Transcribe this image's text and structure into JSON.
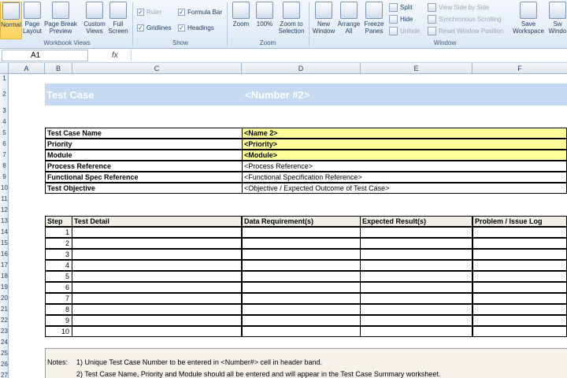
{
  "ribbon": {
    "workbook_views": {
      "buttons": [
        "Normal",
        "Page Layout",
        "Page Break Preview",
        "Custom Views",
        "Full Screen"
      ],
      "label": "Workbook Views"
    },
    "show": {
      "items": [
        {
          "label": "Ruler",
          "checked": true,
          "disabled": true
        },
        {
          "label": "Formula Bar",
          "checked": true,
          "disabled": false
        },
        {
          "label": "Gridlines",
          "checked": true,
          "disabled": false
        },
        {
          "label": "Headings",
          "checked": true,
          "disabled": false
        }
      ],
      "label": "Show"
    },
    "zoom": {
      "buttons": [
        "Zoom",
        "100%",
        "Zoom to Selection"
      ],
      "label": "Zoom"
    },
    "window": {
      "buttons": [
        "New Window",
        "Arrange All",
        "Freeze Panes"
      ],
      "small": [
        {
          "label": "Split",
          "disabled": false
        },
        {
          "label": "Hide",
          "disabled": false
        },
        {
          "label": "Unhide",
          "disabled": true
        },
        {
          "label": "View Side by Side",
          "disabled": true
        },
        {
          "label": "Synchronous Scrolling",
          "disabled": true
        },
        {
          "label": "Reset Window Position",
          "disabled": true
        }
      ],
      "save": "Save Workspace",
      "switch": "Sw Windo",
      "label": "Window"
    }
  },
  "formula_bar": {
    "name_box": "A1",
    "fx": "fx",
    "value": ""
  },
  "columns": [
    "A",
    "B",
    "C",
    "D",
    "E",
    "F"
  ],
  "rows": [
    "1",
    "2",
    "3",
    "4",
    "5",
    "6",
    "7",
    "8",
    "9",
    "10",
    "11",
    "12",
    "13",
    "14",
    "15",
    "16",
    "17",
    "18",
    "19",
    "20",
    "21",
    "22",
    "23",
    "24",
    "25",
    "26",
    "27"
  ],
  "sheet": {
    "title": "Test Case",
    "number": "<Number #2>",
    "info": [
      {
        "label": "Test Case Name",
        "value": "<Name 2>",
        "highlight": true
      },
      {
        "label": "Priority",
        "value": "<Priority>",
        "highlight": true
      },
      {
        "label": "Module",
        "value": "<Module>",
        "highlight": true
      },
      {
        "label": "Process Reference",
        "value": "<Process Reference>",
        "highlight": false
      },
      {
        "label": "Functional Spec Reference",
        "value": "<Functional Specification Reference>",
        "highlight": false
      },
      {
        "label": "Test Objective",
        "value": "<Objective / Expected Outcome of Test Case>",
        "highlight": false
      }
    ],
    "step_headers": [
      "Step",
      "Test Detail",
      "Data Requirement(s)",
      "Expected Result(s)",
      "Problem / Issue Log"
    ],
    "steps": [
      "1",
      "2",
      "3",
      "4",
      "5",
      "6",
      "7",
      "8",
      "9",
      "10"
    ],
    "notes_label": "Notes:",
    "notes": [
      "1) Unique Test Case Number to be entered in <Number#> cell in header band.",
      "2) Test Case Name, Priority and Module should all be entered and will appear in the Test Case Summary worksheet."
    ]
  }
}
